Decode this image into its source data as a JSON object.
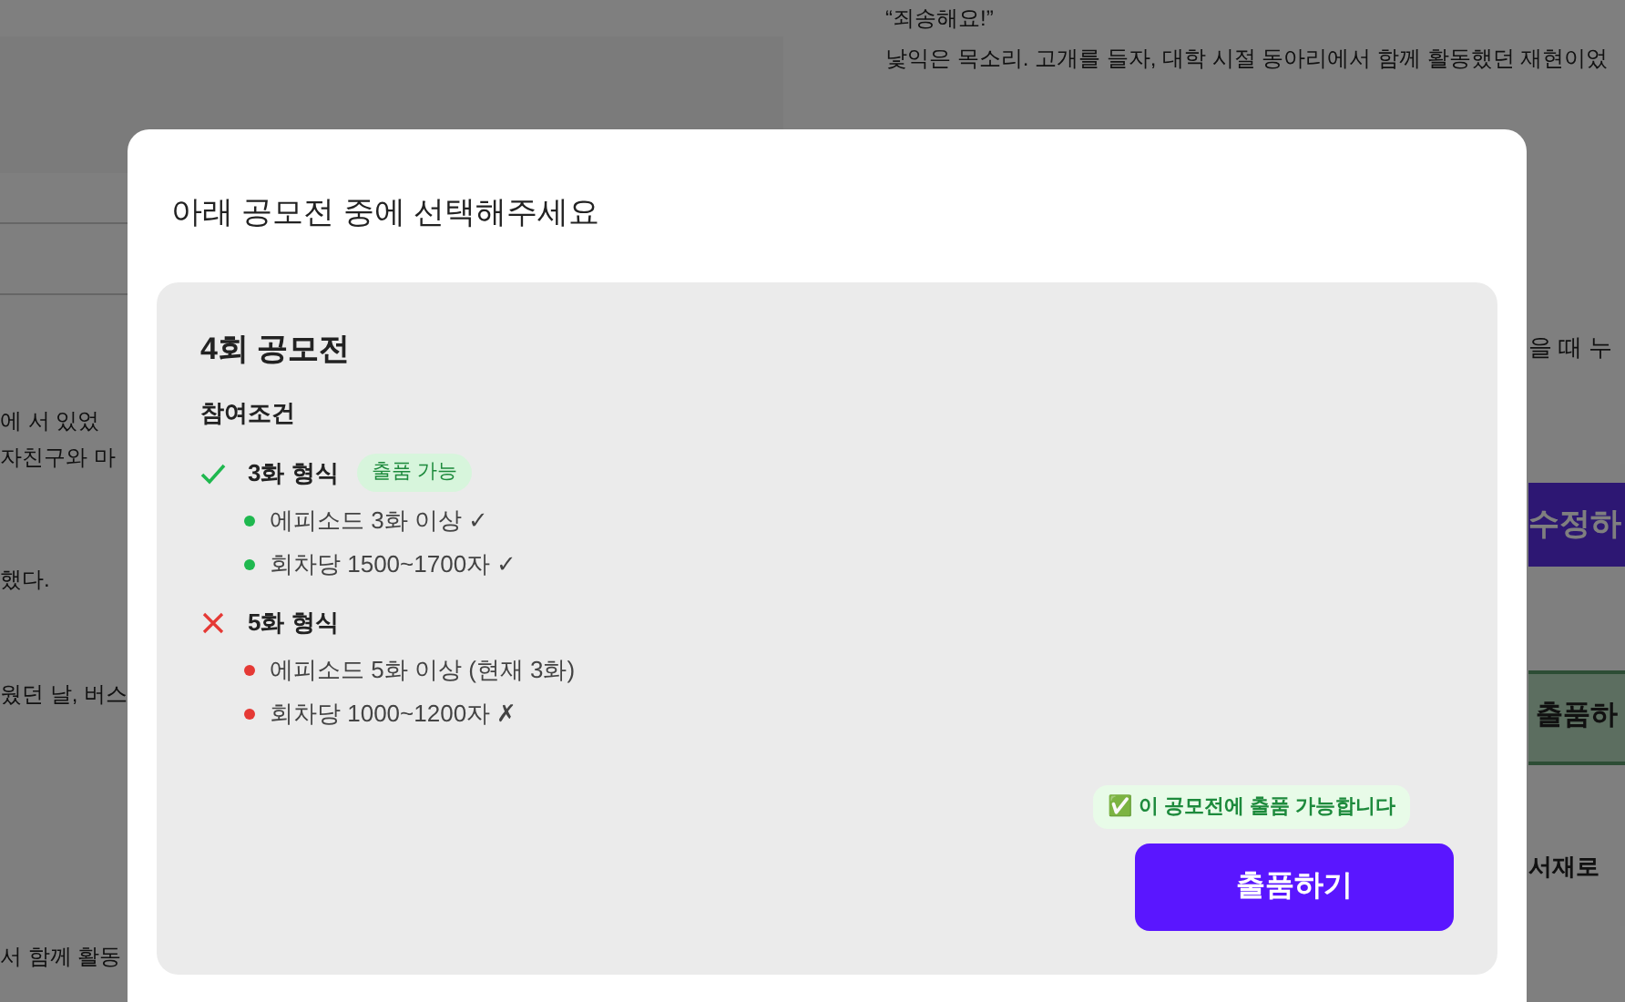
{
  "background": {
    "left_lines": [
      "에 서 있었",
      "자친구와 마",
      "했다.",
      "웠던 날, 버스",
      "서 함께 활동"
    ],
    "right_lines": [
      "“죄송해요!”",
      "낯익은 목소리. 고개를 들자, 대학 시절 동아리에서 함께 활동했던 재현이었"
    ],
    "side_text": "을 때 누",
    "edit_button": "수정하",
    "submit_button": "출품하",
    "library_link": "서재로"
  },
  "modal": {
    "title": "아래 공모전 중에 선택해주세요",
    "contest": {
      "name": "4회 공모전",
      "conditions_label": "참여조건",
      "formats": [
        {
          "name": "3화 형식",
          "met": true,
          "badge": "출품 가능",
          "requirements": [
            {
              "text": "에피소드 3화 이상 ✓",
              "met": true
            },
            {
              "text": "회차당 1500~1700자 ✓",
              "met": true
            }
          ]
        },
        {
          "name": "5화 형식",
          "met": false,
          "requirements": [
            {
              "text": "에피소드 5화 이상 (현재 3화)",
              "met": false
            },
            {
              "text": "회차당 1000~1200자 ✗",
              "met": false
            }
          ]
        }
      ],
      "eligibility": "✅ 이 공모전에 출품 가능합니다",
      "submit_button": "출품하기"
    }
  }
}
